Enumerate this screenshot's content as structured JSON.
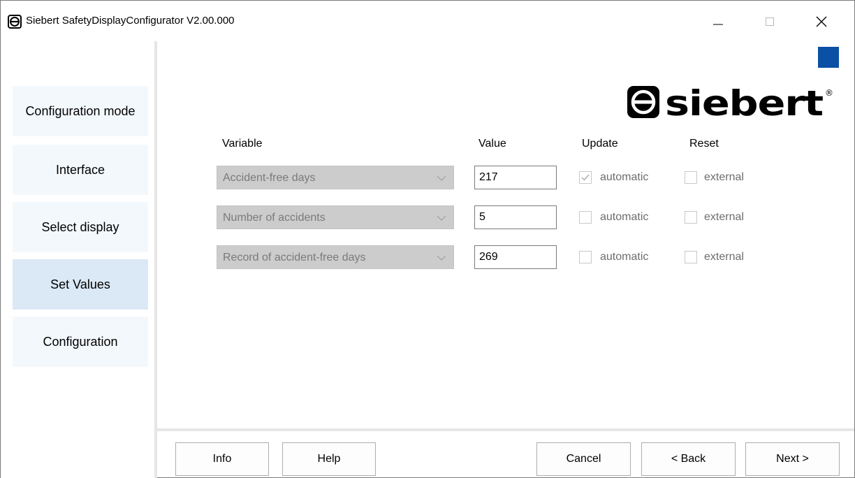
{
  "window": {
    "title": "Siebert SafetyDisplayConfigurator V2.00.000"
  },
  "sidebar": {
    "items": [
      {
        "label": "Configuration mode"
      },
      {
        "label": "Interface"
      },
      {
        "label": "Select display"
      },
      {
        "label": "Set Values",
        "active": true
      },
      {
        "label": "Configuration"
      }
    ]
  },
  "brand": {
    "logo_text": "siebert",
    "accent_color": "#0a50a4"
  },
  "table": {
    "headers": {
      "variable": "Variable",
      "value": "Value",
      "update": "Update",
      "reset": "Reset"
    },
    "rows": [
      {
        "variable": "Accident-free days",
        "value": "217",
        "update_label": "automatic",
        "update_checked": true,
        "update_enabled": false,
        "reset_label": "external",
        "reset_checked": false
      },
      {
        "variable": "Number of accidents",
        "value": "5",
        "update_label": "automatic",
        "update_checked": false,
        "update_enabled": false,
        "reset_label": "external",
        "reset_checked": false
      },
      {
        "variable": "Record of accident-free days",
        "value": "269",
        "update_label": "automatic",
        "update_checked": false,
        "update_enabled": false,
        "reset_label": "external",
        "reset_checked": false
      }
    ]
  },
  "buttons": {
    "info": "Info",
    "help": "Help",
    "cancel": "Cancel",
    "back": "< Back",
    "next": "Next >"
  }
}
